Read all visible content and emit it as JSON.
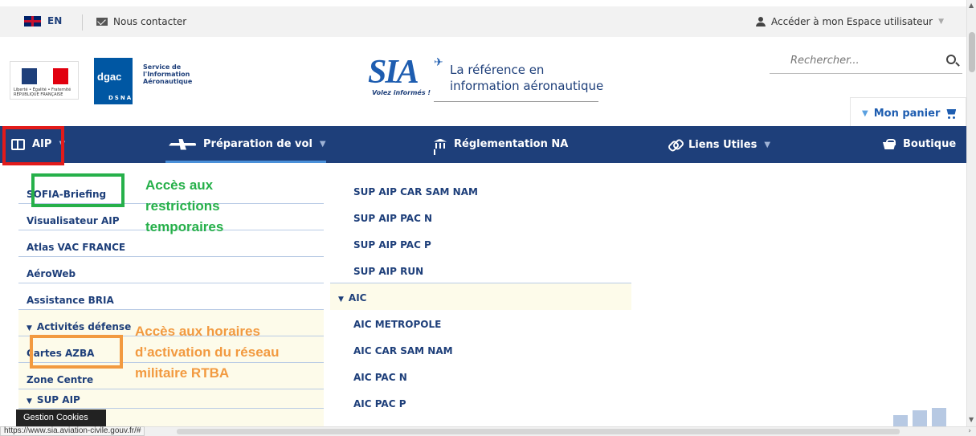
{
  "topbar": {
    "lang_label": "EN",
    "contact_label": "Nous contacter",
    "account_label": "Accéder à mon Espace utilisateur"
  },
  "header": {
    "dgac_name": "dgac",
    "dgac_service": "Service de l'Information Aéronautique",
    "dgac_dsna": "DSNA",
    "sia_logo": "SIA",
    "sia_tagline": "Volez informés !",
    "sia_reference_line1": "La référence en",
    "sia_reference_line2": "information aéronautique",
    "rf_text": "Liberté • Égalité • Fraternité RÉPUBLIQUE FRANÇAISE",
    "search_placeholder": "Rechercher...",
    "cart_label": "Mon panier"
  },
  "nav": {
    "items": [
      {
        "label": "AIP",
        "icon": "book-icon"
      },
      {
        "label": "Préparation de vol",
        "icon": "plane-icon"
      },
      {
        "label": "Réglementation NA",
        "icon": "bank-icon"
      },
      {
        "label": "Liens Utiles",
        "icon": "link-icon"
      },
      {
        "label": "Boutique",
        "icon": "basket-icon"
      }
    ]
  },
  "menu": {
    "col1": [
      "SOFIA-Briefing",
      "Visualisateur AIP",
      "Atlas VAC FRANCE",
      "AéroWeb",
      "Assistance BRIA",
      "Activités défense",
      "Cartes AZBA",
      "Zone Centre",
      "SUP AIP"
    ],
    "col2": [
      "SUP AIP CAR SAM NAM",
      "SUP AIP PAC N",
      "SUP AIP PAC P",
      "SUP AIP RUN",
      "AIC",
      "AIC METROPOLE",
      "AIC CAR SAM NAM",
      "AIC PAC N",
      "AIC PAC P"
    ]
  },
  "annotations": {
    "green_note": "Accès aux restrictions temporaires",
    "orange_note": "Accès aux horaires d’activation du réseau militaire RTBA"
  },
  "footer": {
    "cookies_label": "Gestion Cookies",
    "status_url": "https://www.sia.aviation-civile.gouv.fr/#"
  },
  "colors": {
    "nav_bg": "#1e3f7a",
    "accent_blue": "#1e5db0",
    "highlight_red": "#e21b1b",
    "highlight_green": "#26b04a",
    "highlight_orange": "#f29a40",
    "menu_shade": "#fdfbea"
  }
}
